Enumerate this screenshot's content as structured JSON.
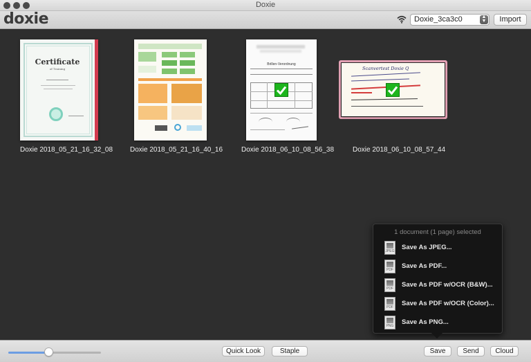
{
  "window": {
    "title": "Doxie"
  },
  "toolbar": {
    "logo": "doxie",
    "device": "Doxie_3ca3c0",
    "import_label": "Import"
  },
  "documents": [
    {
      "name": "Doxie 2018_05_21_16_32_08",
      "thumb_text": "Certificate",
      "thumb_sub": "of Training",
      "selected": false,
      "checked": false
    },
    {
      "name": "Doxie 2018_05_21_16_40_16",
      "selected": false,
      "checked": false
    },
    {
      "name": "Doxie 2018_06_10_08_56_38",
      "thumb_text": "Brillen-Verordnung",
      "selected": false,
      "checked": true
    },
    {
      "name": "Doxie 2018_06_10_08_57_44",
      "thumb_text": "Scanvertest Doxie Q",
      "selected": true,
      "checked": true
    }
  ],
  "popup": {
    "header": "1 document (1 page) selected",
    "items": [
      {
        "label": "Save As JPEG...",
        "icon": "jpeg-file-icon",
        "tag": "JPEG"
      },
      {
        "label": "Save As PDF...",
        "icon": "pdf-file-icon",
        "tag": "PDF"
      },
      {
        "label": "Save As PDF w/OCR (B&W)...",
        "icon": "pdf-file-icon",
        "tag": "PDF"
      },
      {
        "label": "Save As PDF w/OCR (Color)...",
        "icon": "pdf-file-icon",
        "tag": "PDF"
      },
      {
        "label": "Save As PNG...",
        "icon": "png-file-icon",
        "tag": "PNG"
      }
    ]
  },
  "bottombar": {
    "zoom_slider": 0.43,
    "quick_look_label": "Quick Look",
    "staple_label": "Staple",
    "save_label": "Save",
    "send_label": "Send",
    "cloud_label": "Cloud"
  },
  "colors": {
    "selection_border": "#e6a3b6",
    "check_green": "#1db51d",
    "slider_accent": "#6c9de3"
  }
}
